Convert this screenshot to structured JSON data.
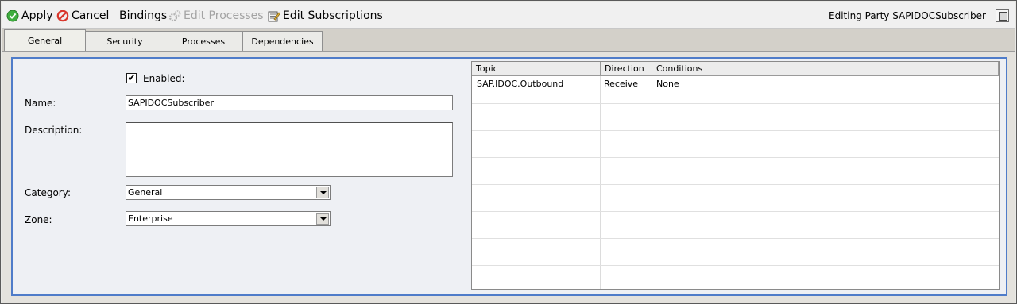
{
  "toolbar": {
    "apply_label": "Apply",
    "cancel_label": "Cancel",
    "bindings_label": "Bindings",
    "edit_processes_label": "Edit Processes",
    "edit_subscriptions_label": "Edit Subscriptions",
    "editing_text": "Editing Party SAPIDOCSubscriber",
    "icons": {
      "apply": "check-circle-icon",
      "cancel": "no-entry-icon",
      "edit_processes": "gears-icon",
      "edit_subscriptions": "edit-list-icon",
      "maximize": "maximize-icon"
    }
  },
  "tabs": [
    {
      "label": "General",
      "active": true
    },
    {
      "label": "Security",
      "active": false
    },
    {
      "label": "Processes",
      "active": false
    },
    {
      "label": "Dependencies",
      "active": false
    }
  ],
  "form": {
    "enabled_label": "Enabled:",
    "enabled_checked": true,
    "name_label": "Name:",
    "name_value": "SAPIDOCSubscriber",
    "description_label": "Description:",
    "description_value": "",
    "category_label": "Category:",
    "category_value": "General",
    "zone_label": "Zone:",
    "zone_value": "Enterprise"
  },
  "subscriptions_table": {
    "columns": [
      "Topic",
      "Direction",
      "Conditions"
    ],
    "rows": [
      [
        "SAP.IDOC.Outbound",
        "Receive",
        "None"
      ]
    ]
  },
  "colors": {
    "panel_border": "#4f7cc9",
    "apply_icon": "#3fae3f",
    "cancel_icon": "#d9362b"
  }
}
